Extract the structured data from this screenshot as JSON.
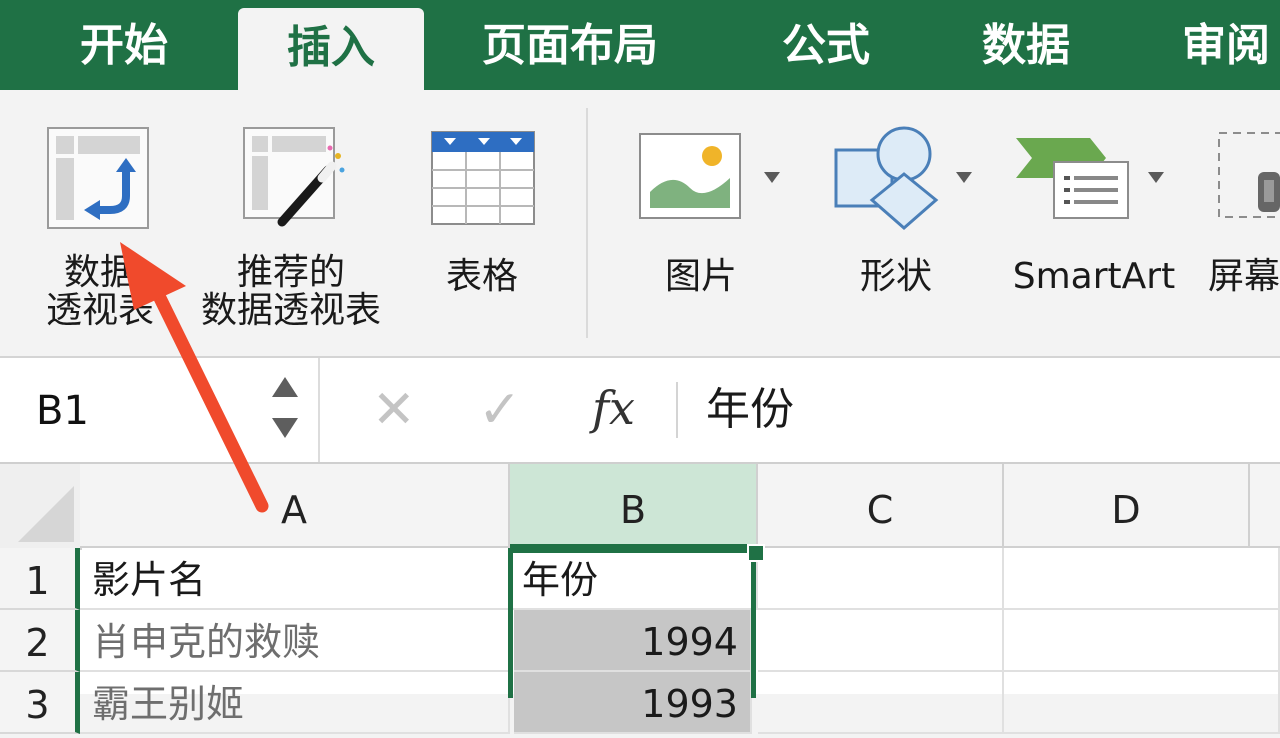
{
  "tabs": [
    {
      "label": "开始",
      "active": false
    },
    {
      "label": "插入",
      "active": true
    },
    {
      "label": "页面布局",
      "active": false
    },
    {
      "label": "公式",
      "active": false
    },
    {
      "label": "数据",
      "active": false
    },
    {
      "label": "审阅",
      "active": false
    }
  ],
  "ribbon": {
    "pivot_table": {
      "line1": "数据",
      "line2": "透视表",
      "icon": "pivot-table-icon"
    },
    "recommended_pivot": {
      "line1": "推荐的",
      "line2": "数据透视表",
      "icon": "recommended-pivot-icon"
    },
    "table": {
      "label": "表格",
      "icon": "table-icon"
    },
    "picture": {
      "label": "图片",
      "icon": "picture-icon"
    },
    "shapes": {
      "label": "形状",
      "icon": "shapes-icon"
    },
    "smartart": {
      "label": "SmartArt",
      "icon": "smartart-icon"
    },
    "screenshot": {
      "label": "屏幕",
      "icon": "screenshot-icon"
    }
  },
  "formula_bar": {
    "name_box": "B1",
    "cancel_glyph": "✕",
    "enter_glyph": "✓",
    "fx_label": "fx",
    "content": "年份"
  },
  "grid": {
    "columns": [
      "A",
      "B",
      "C",
      "D"
    ],
    "selected_column": "B",
    "rows": [
      {
        "num": "1",
        "a": "影片名",
        "b": "年份"
      },
      {
        "num": "2",
        "a": "肖申克的救赎",
        "b": "1994"
      },
      {
        "num": "3",
        "a": "霸王别姬",
        "b": "1993"
      }
    ]
  },
  "colors": {
    "accent": "#1f7145",
    "annotation_arrow": "#f04a2c"
  }
}
